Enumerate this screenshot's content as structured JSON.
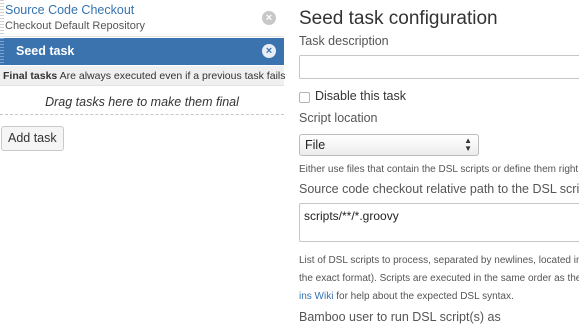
{
  "tasks": [
    {
      "title": "Source Code Checkout",
      "subtitle": "Checkout Default Repository"
    },
    {
      "title": "Seed task"
    }
  ],
  "final_tasks": {
    "bold": "Final tasks",
    "text": " Are always executed even if a previous task fails"
  },
  "dropzone_text": "Drag tasks here to make them final",
  "add_task_label": "Add task",
  "config": {
    "title": "Seed task configuration",
    "task_description_label": "Task description",
    "task_description_value": "",
    "disable_label": "Disable this task",
    "disable_checked": false,
    "script_location_label": "Script location",
    "script_location_value": "File",
    "script_location_help": "Either use files that contain the DSL scripts or define them right i",
    "relative_path_label": "Source code checkout relative path to the DSL script(s)",
    "relative_path_value": "scripts/**/*.groovy",
    "help_line1": "List of DSL scripts to process, separated by newlines, located in",
    "help_line2": "the exact format). Scripts are executed in the same order as they",
    "help_line3_link": "ins Wiki",
    "help_line3_rest": " for help about the expected DSL syntax.",
    "bamboo_user_label": "Bamboo user to run DSL script(s) as"
  },
  "colors": {
    "selected_task_bg": "#3b73af",
    "link": "#3572b0"
  }
}
